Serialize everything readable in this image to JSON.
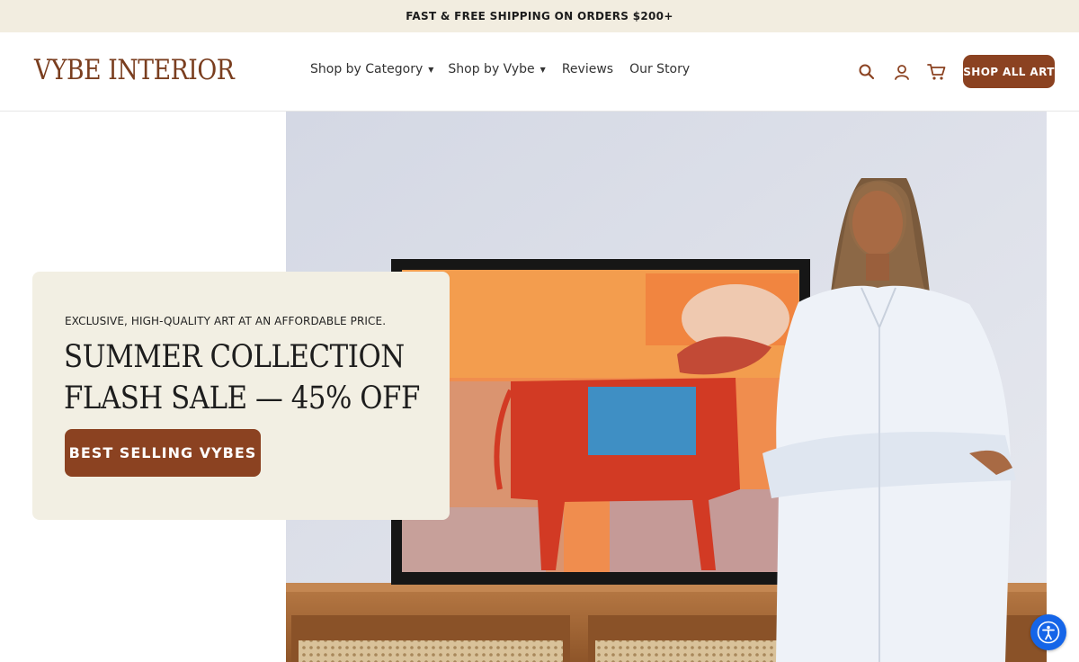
{
  "announcement": {
    "text": "FAST & FREE SHIPPING ON ORDERS $200+"
  },
  "header": {
    "logo": "VYBE INTERIOR",
    "nav": [
      {
        "label": "Shop by Category",
        "has_dropdown": true
      },
      {
        "label": "Shop by Vybe",
        "has_dropdown": true
      },
      {
        "label": "Reviews",
        "has_dropdown": false
      },
      {
        "label": "Our Story",
        "has_dropdown": false
      }
    ],
    "icons": [
      "search-icon",
      "account-icon",
      "cart-icon"
    ],
    "cta_label": "SHOP ALL ART"
  },
  "hero": {
    "eyebrow": "EXCLUSIVE, HIGH-QUALITY ART AT AN AFFORDABLE PRICE.",
    "title_line1": "SUMMER COLLECTION",
    "title_line2": "FLASH SALE — 45% OFF",
    "button_label": "BEST SELLING VYBES"
  },
  "accessibility": {
    "icon": "accessibility-icon"
  },
  "colors": {
    "brand": "#8b4221",
    "logo": "#7a3e1f",
    "announcement_bg": "#f2ede0",
    "promo_bg": "#f2efe3",
    "accessibility_blue": "#1565e8"
  }
}
